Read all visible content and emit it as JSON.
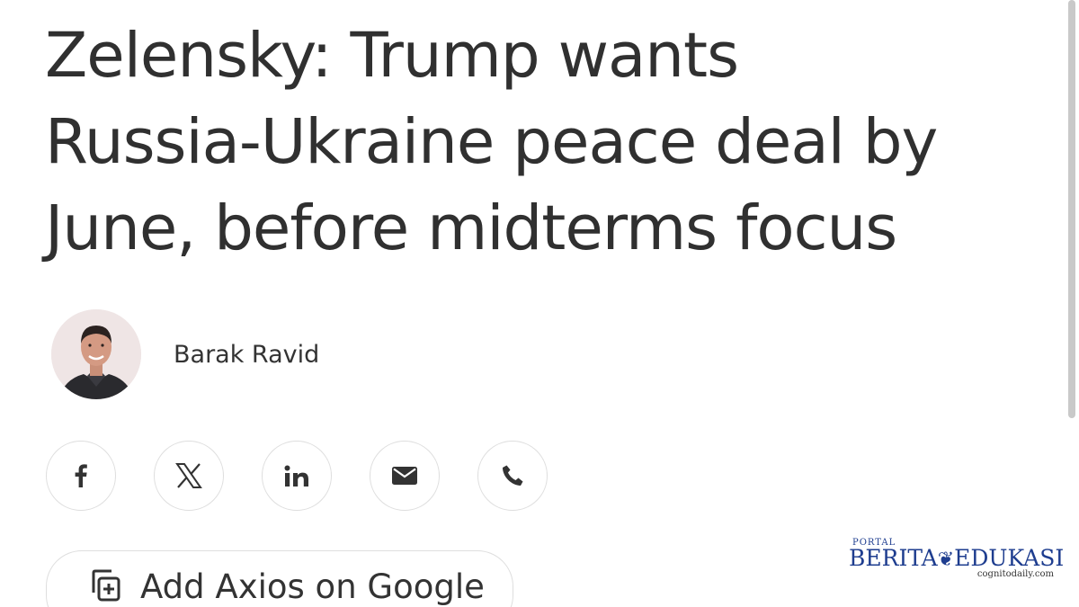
{
  "article": {
    "headline_lines": [
      "Zelensky: Trump wants",
      "Russia-Ukraine peace deal by",
      "June, before midterms focus"
    ],
    "author_name": "Barak Ravid"
  },
  "share": {
    "buttons": [
      {
        "icon": "facebook-icon"
      },
      {
        "icon": "x-icon"
      },
      {
        "icon": "linkedin-icon"
      },
      {
        "icon": "email-icon"
      },
      {
        "icon": "phone-icon"
      }
    ]
  },
  "google": {
    "label": "Add Axios on Google",
    "icon": "add-to-collection-icon"
  },
  "watermark": {
    "top": "PORTAL",
    "left": "BERITA",
    "right": "EDUKASI",
    "site": "cognitodaily.com",
    "color": "#1e3d8f"
  }
}
